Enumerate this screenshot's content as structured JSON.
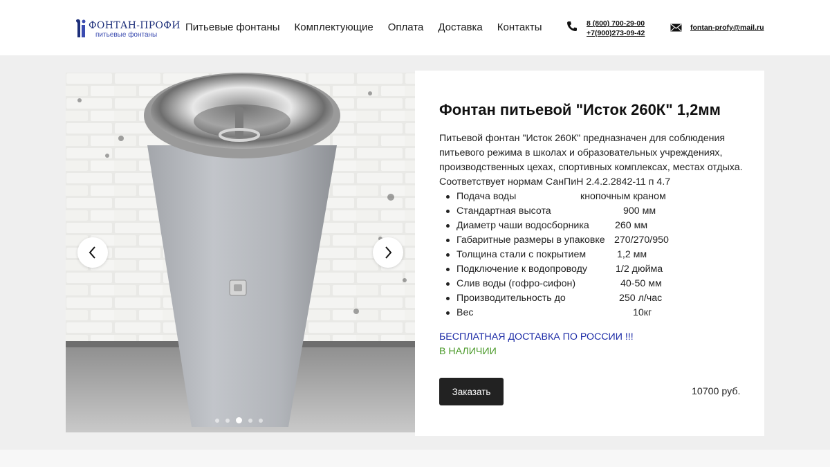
{
  "header": {
    "logo_title": "ФОНТАН-ПРОФИ",
    "logo_subtitle": "питьевые фонтаны",
    "nav": [
      "Питьевые фонтаны",
      "Комплектующие",
      "Оплата",
      "Доставка",
      "Контакты"
    ],
    "phones": [
      "8 (800) 700-29-00",
      "+7(900)273-09-42"
    ],
    "email": "fontan-profy@mail.ru"
  },
  "gallery": {
    "slide_count": 5,
    "active_slide": 3
  },
  "product": {
    "title": "Фонтан питьевой \"Исток 260К\" 1,2мм",
    "description": "Питьевой фонтан \"Исток 260К\" предназначен для соблюдения питьевого режима  в школах и образовательных учреждениях, производственных цехах, спортивных комплексах, местах отдыха. Соответствует нормам СанПиН 2.4.2.2842-11 п 4.7",
    "specs": [
      {
        "name": "Подача воды",
        "value": "кнопочным краном"
      },
      {
        "name": "Стандартная высота",
        "value": "900 мм"
      },
      {
        "name": "Диаметр чаши водосборника",
        "value": "260 мм"
      },
      {
        "name": "Габаритные размеры в упаковке",
        "value": "270/270/950"
      },
      {
        "name": "Толщина  стали с покрытием",
        "value": "1,2 мм"
      },
      {
        "name": "Подключение к водопроводу",
        "value": "1/2 дюйма"
      },
      {
        "name": "Слив воды (гофро-сифон)",
        "value": "40-50 мм"
      },
      {
        "name": "Производительность до",
        "value": "250 л/час"
      },
      {
        "name": "Вес",
        "value": "10кг"
      }
    ],
    "delivery_note": "БЕСПЛАТНАЯ ДОСТАВКА ПО РОССИИ !!!",
    "stock_note": "В НАЛИЧИИ",
    "order_label": "Заказать",
    "price": "10700 руб."
  },
  "colors": {
    "accent_dark": "#222222",
    "delivery_blue": "#1b2aa6",
    "stock_green": "#4b9a2a",
    "band_bg": "#efefef"
  }
}
